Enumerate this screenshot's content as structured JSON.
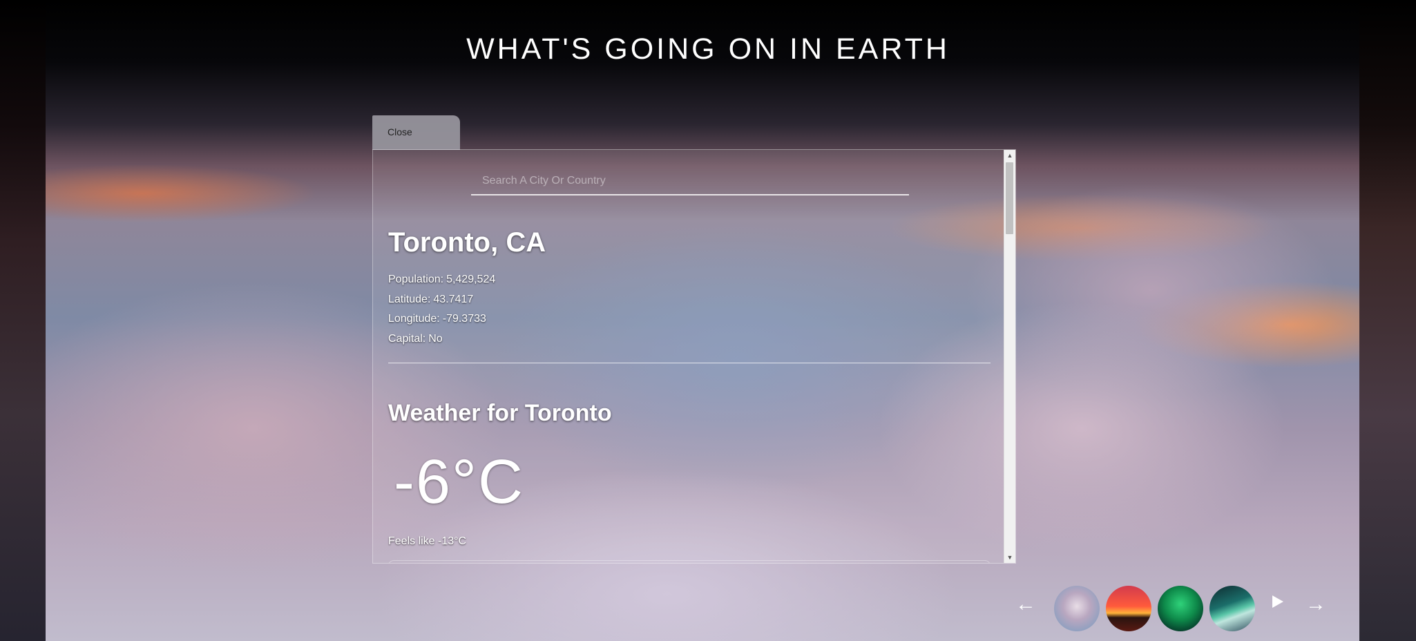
{
  "header": {
    "title": "WHAT'S GOING ON IN EARTH"
  },
  "panel": {
    "close_label": "Close",
    "search": {
      "placeholder": "Search A City Or Country",
      "value": ""
    },
    "city": {
      "name": "Toronto, CA",
      "population_label": "Population:",
      "population": "5,429,524",
      "latitude_label": "Latitude:",
      "latitude": "43.7417",
      "longitude_label": "Longitude:",
      "longitude": "-79.3733",
      "capital_label": "Capital:",
      "capital": "No"
    },
    "weather": {
      "title": "Weather for Toronto",
      "temperature": "-6°C",
      "feels_like": "Feels like -13°C"
    }
  },
  "carousel": {
    "prev_icon": "arrow-left-icon",
    "next_icon": "arrow-right-icon",
    "play_icon": "play-icon",
    "thumbnails": [
      "clouds",
      "sunset",
      "aurora-green",
      "aurora-lake"
    ]
  }
}
